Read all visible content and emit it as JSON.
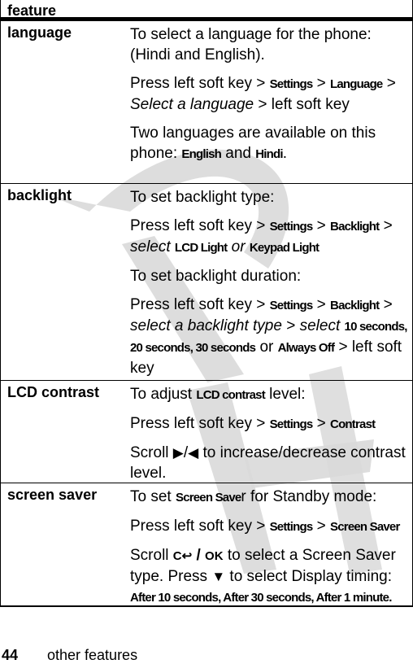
{
  "table": {
    "header": "feature",
    "rows": [
      {
        "feature": "language",
        "intro": "To select a language for the phone: (Hindi and English).",
        "path": {
          "prefix": "Press left soft key > ",
          "k1": "Settings",
          "sep1": " > ",
          "k2": "Language",
          "sep2": " > ",
          "italic": "Select a language",
          "suffix": " > left soft key"
        },
        "note": {
          "prefix": "Two languages are available on this phone: ",
          "k1": "English",
          "mid": " and ",
          "k2": "Hindi",
          "suffix": "."
        }
      },
      {
        "feature": "backlight",
        "type_intro": "To set backlight type:",
        "type_path": {
          "prefix": "Press left soft key > ",
          "k1": "Settings",
          "sep1": " > ",
          "k2": "Backlight",
          "sep2": " > ",
          "italic1": "select",
          "k3": "LCD Light",
          "italic2": "or",
          "k4": "Keypad Light"
        },
        "duration_intro": "To set backlight duration:",
        "duration_path": {
          "prefix": "Press left soft key > ",
          "k1": "Settings",
          "sep1": " > ",
          "k2": "Backlight",
          "sep2": " > ",
          "italic1": "select a backlight type",
          "sep3": " > ",
          "italic2": "select",
          "k3": "10 seconds",
          "c1": ", ",
          "k4": "20 seconds",
          "c2": ", ",
          "k5": "30 seconds",
          "or": " or ",
          "k6": "Always Off",
          "suffix": " > left soft key"
        }
      },
      {
        "feature": "LCD contrast",
        "intro": {
          "prefix": "To adjust ",
          "k1": "LCD contrast",
          "suffix": " level:"
        },
        "path": {
          "prefix": "Press left soft key > ",
          "k1": "Settings",
          "sep1": " > ",
          "k2": "Contrast"
        },
        "scroll": {
          "prefix": "Scroll ",
          "right_glyph": "▶",
          "slash": "/",
          "left_glyph": "◀",
          "suffix": " to increase/decrease contrast level."
        }
      },
      {
        "feature": "screen saver",
        "intro": {
          "prefix": "To set ",
          "k1": "Screen Save",
          "suffix": "r for Standby mode:"
        },
        "path": {
          "prefix": "Press left soft key > ",
          "k1": "Settings",
          "sep1": " > ",
          "k2": "Screen Saver"
        },
        "scroll": {
          "prefix": "Scroll ",
          "clear_glyph": "C↩",
          "slash": " / ",
          "ok_glyph": "OK",
          "mid": " to select a Screen Saver type. Press ",
          "down_glyph": "▼",
          "mid2": " to select Display timing: ",
          "k1": "After 10 seconds",
          "c1": ", ",
          "k2": "After 30 seconds",
          "c2": ", ",
          "k3": "After 1 minute",
          "suffix": "."
        }
      }
    ]
  },
  "watermark": "DRAFT",
  "footer": {
    "page_number": "44",
    "section_title": "other features"
  }
}
